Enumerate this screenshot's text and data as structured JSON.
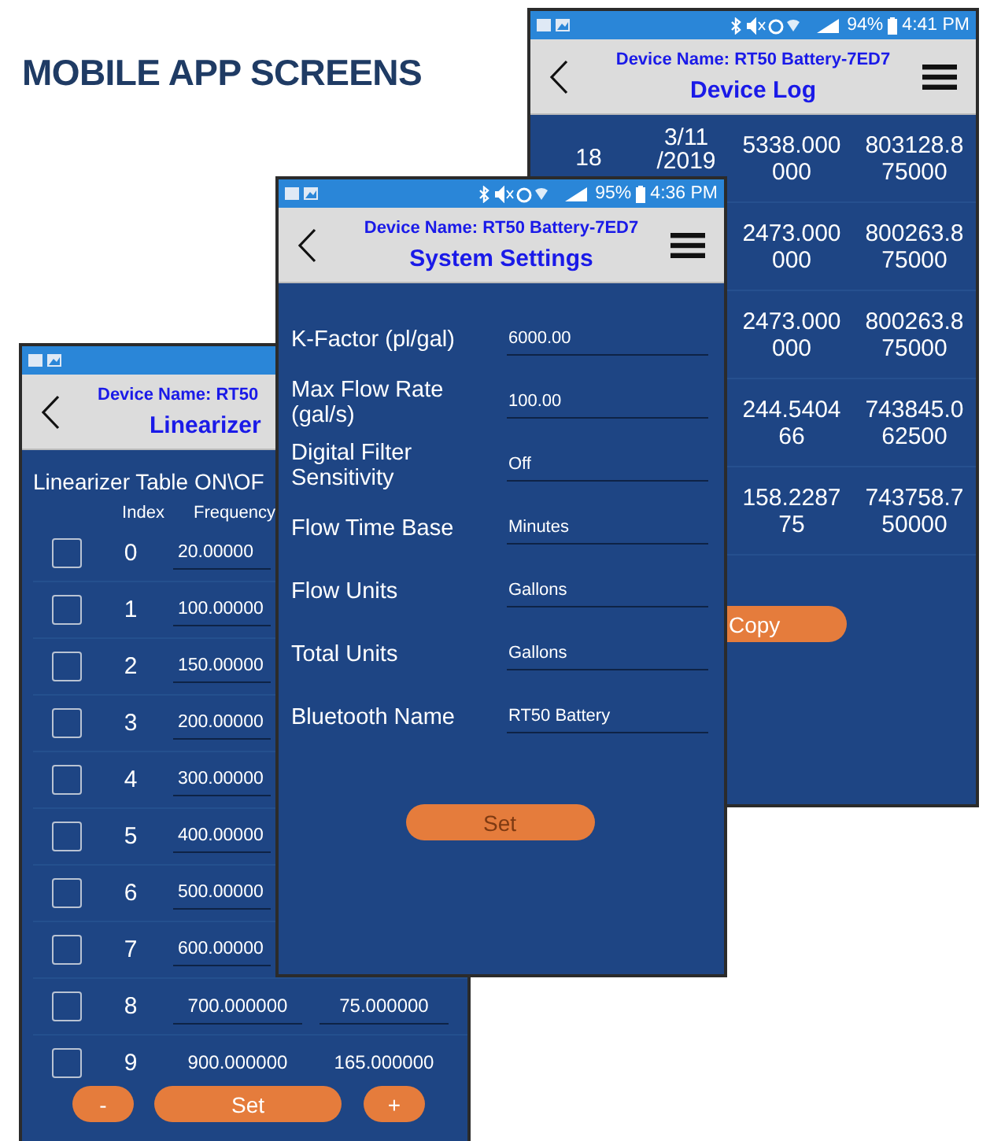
{
  "heading": "MOBILE APP SCREENS",
  "device_log": {
    "status_bar": {
      "battery": "94%",
      "time": "4:41 PM"
    },
    "device_name": "Device Name: RT50 Battery-7ED7",
    "title": "Device Log",
    "rows": [
      {
        "index": "18",
        "date": "3/11 /2019",
        "value": "5338.000000",
        "total": "803128.875000"
      },
      {
        "value": "2473.000000",
        "total": "800263.875000"
      },
      {
        "value": "2473.000000",
        "total": "800263.875000"
      },
      {
        "value": "244.540466",
        "total": "743845.062500"
      },
      {
        "value": "158.228775",
        "total": "743758.750000"
      }
    ],
    "copy_button": "Copy"
  },
  "system_settings": {
    "status_bar": {
      "battery": "95%",
      "time": "4:36 PM"
    },
    "device_name": "Device Name: RT50 Battery-7ED7",
    "title": "System Settings",
    "fields": [
      {
        "label": "K-Factor (pl/gal)",
        "value": "6000.00"
      },
      {
        "label": "Max Flow Rate (gal/s)",
        "value": "100.00"
      },
      {
        "label": "Digital Filter Sensitivity",
        "value": "Off"
      },
      {
        "label": "Flow Time Base",
        "value": "Minutes"
      },
      {
        "label": "Flow Units",
        "value": "Gallons"
      },
      {
        "label": "Total Units",
        "value": "Gallons"
      },
      {
        "label": "Bluetooth Name",
        "value": "RT50 Battery"
      }
    ],
    "set_button": {
      "label": "Set",
      "disabled": true
    }
  },
  "linearizer": {
    "device_name": "Device Name: RT50 ",
    "title": "Linearizer",
    "table_label": "Linearizer Table ON\\OF",
    "columns": [
      "Index",
      "Frequency"
    ],
    "rows": [
      {
        "checked": false,
        "index": "0",
        "frequency": "20.00000"
      },
      {
        "checked": false,
        "index": "1",
        "frequency": "100.00000"
      },
      {
        "checked": false,
        "index": "2",
        "frequency": "150.00000"
      },
      {
        "checked": false,
        "index": "3",
        "frequency": "200.00000"
      },
      {
        "checked": false,
        "index": "4",
        "frequency": "300.00000"
      },
      {
        "checked": false,
        "index": "5",
        "frequency": "400.00000"
      },
      {
        "checked": false,
        "index": "6",
        "frequency": "500.00000"
      },
      {
        "checked": false,
        "index": "7",
        "frequency": "600.00000"
      },
      {
        "checked": false,
        "index": "8",
        "frequency": "700.000000",
        "column_3": "75.000000"
      },
      {
        "checked": false,
        "index": "9",
        "frequency": "900.000000",
        "column_3": "165.000000"
      }
    ],
    "buttons": [
      "-",
      "Set",
      "+"
    ]
  }
}
